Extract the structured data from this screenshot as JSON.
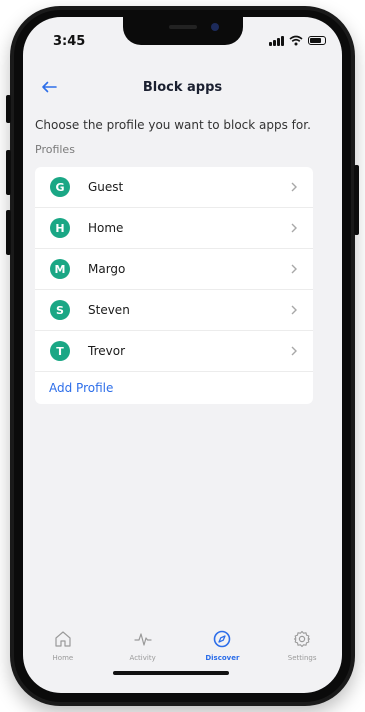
{
  "status": {
    "time": "3:45"
  },
  "header": {
    "title": "Block apps"
  },
  "intro": "Choose the profile you want to block apps for.",
  "section_label": "Profiles",
  "profiles": [
    {
      "initial": "G",
      "name": "Guest"
    },
    {
      "initial": "H",
      "name": "Home"
    },
    {
      "initial": "M",
      "name": "Margo"
    },
    {
      "initial": "S",
      "name": "Steven"
    },
    {
      "initial": "T",
      "name": "Trevor"
    }
  ],
  "add_profile_label": "Add Profile",
  "tabs": [
    {
      "label": "Home",
      "icon": "home-icon"
    },
    {
      "label": "Activity",
      "icon": "activity-icon"
    },
    {
      "label": "Discover",
      "icon": "compass-icon",
      "active": true
    },
    {
      "label": "Settings",
      "icon": "gear-icon"
    }
  ],
  "colors": {
    "accent": "#2d6ee9",
    "avatar": "#1aa785"
  }
}
